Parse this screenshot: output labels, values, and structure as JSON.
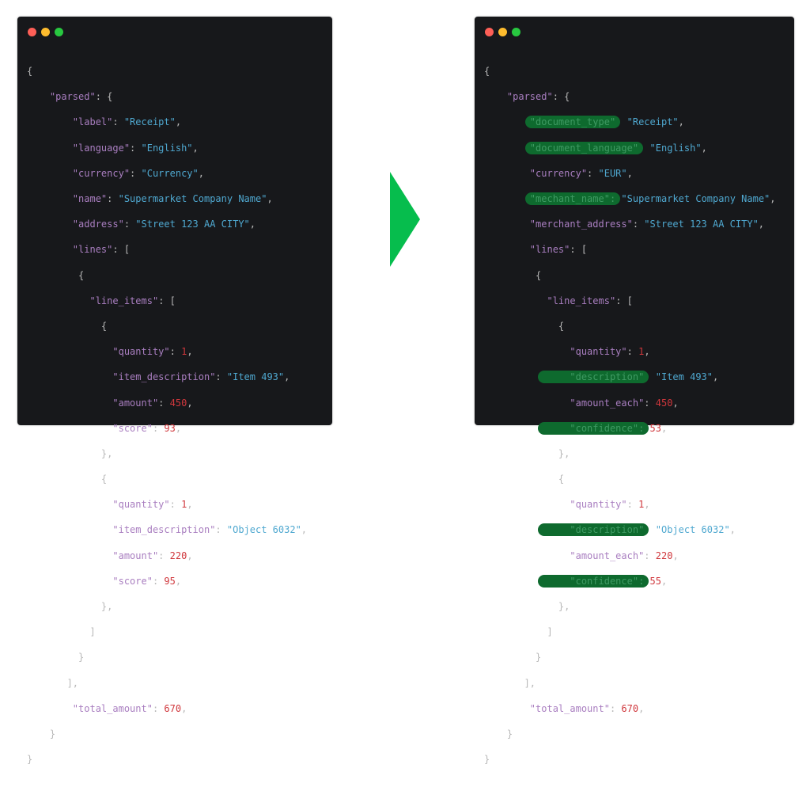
{
  "colors": {
    "key": "#a97ec0",
    "string": "#4fa8d0",
    "number": "#d0373c",
    "punct": "#b8b8b8",
    "highlight": "#0e6a2e",
    "arrow": "#06bd4d",
    "panel_bg": "#17181b"
  },
  "window_controls": [
    "close",
    "minimize",
    "maximize"
  ],
  "left": {
    "parsed_key": "\"parsed\"",
    "fields": [
      {
        "key": "\"label\"",
        "value": "\"Receipt\""
      },
      {
        "key": "\"language\"",
        "value": "\"English\""
      },
      {
        "key": "\"currency\"",
        "value": "\"Currency\""
      },
      {
        "key": "\"name\"",
        "value": "\"Supermarket Company Name\""
      },
      {
        "key": "\"address\"",
        "value": "\"Street 123 AA CITY\""
      }
    ],
    "lines_key": "\"lines\"",
    "line_items_key": "\"line_items\"",
    "items": [
      {
        "quantity_key": "\"quantity\"",
        "quantity": "1",
        "desc_key": "\"item_description\"",
        "desc": "\"Item 493\"",
        "amount_key": "\"amount\"",
        "amount": "450",
        "score_key": "\"score\"",
        "score": "93"
      },
      {
        "quantity_key": "\"quantity\"",
        "quantity": "1",
        "desc_key": "\"item_description\"",
        "desc": "\"Object 6032\"",
        "amount_key": "\"amount\"",
        "amount": "220",
        "score_key": "\"score\"",
        "score": "95"
      }
    ],
    "total_key": "\"total_amount\"",
    "total": "670"
  },
  "right": {
    "parsed_key": "\"parsed\"",
    "fields": [
      {
        "key": "\"document_type\"",
        "value": "\"Receipt\"",
        "highlighted": true
      },
      {
        "key": "\"document_language\"",
        "value": "\"English\"",
        "highlighted": true
      },
      {
        "key": "\"currency\"",
        "value": "\"EUR\"",
        "highlighted": false
      },
      {
        "key": "\"mechant_name\"",
        "value": "\"Supermarket Company Name\"",
        "highlighted": true
      },
      {
        "key": "\"merchant_address\"",
        "value": "\"Street 123 AA CITY\"",
        "highlighted": false
      }
    ],
    "lines_key": "\"lines\"",
    "line_items_key": "\"line_items\"",
    "items": [
      {
        "quantity_key": "\"quantity\"",
        "quantity": "1",
        "desc_key": "\"description\"",
        "desc": "\"Item 493\"",
        "amount_key": "\"amount_each\"",
        "amount": "450",
        "score_key": "\"confidence\"",
        "score": "53"
      },
      {
        "quantity_key": "\"quantity\"",
        "quantity": "1",
        "desc_key": "\"description\"",
        "desc": "\"Object 6032\"",
        "amount_key": "\"amount_each\"",
        "amount": "220",
        "score_key": "\"confidence\"",
        "score": "55"
      }
    ],
    "total_key": "\"total_amount\"",
    "total": "670"
  }
}
